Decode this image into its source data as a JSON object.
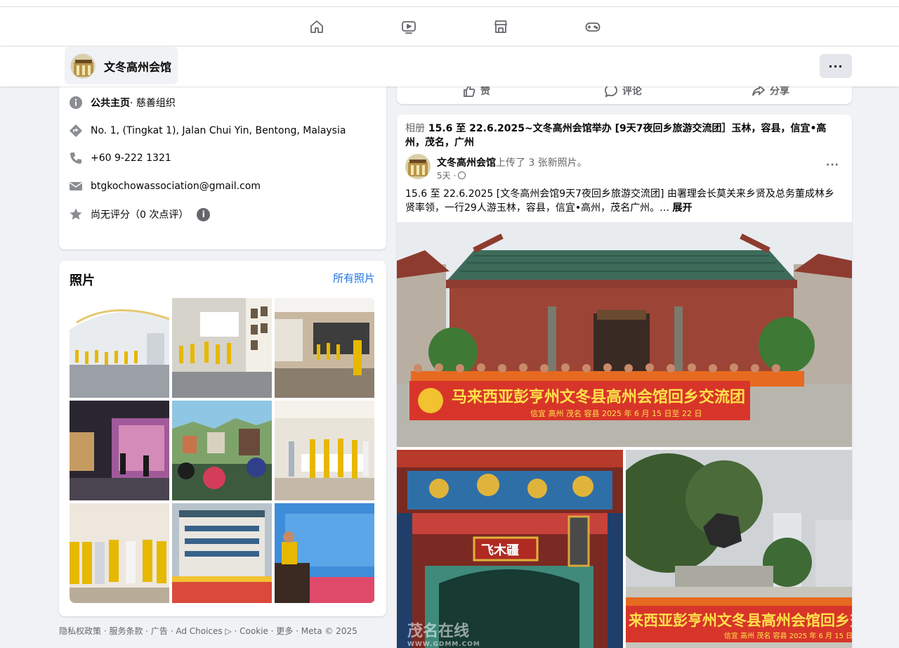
{
  "nav": {
    "icons": [
      "home-icon",
      "video-icon",
      "marketplace-icon",
      "gaming-icon"
    ]
  },
  "page": {
    "name": "文冬高州会馆",
    "more_label": "···"
  },
  "intro": {
    "category_bold": "公共主页",
    "category_rest": " · 慈善组织",
    "address": "No. 1, (Tingkat 1), Jalan Chui Yin, Bentong, Malaysia",
    "phone": "+60 9-222 1321",
    "email": "btgkochowassociation@gmail.com",
    "rating": "尚无评分（0 次点评）",
    "info_badge": "i"
  },
  "photos": {
    "title": "照片",
    "all_link": "所有照片"
  },
  "footer": {
    "text": "隐私权政策 · 服务条款 · 广告 · Ad Choices ▷ · Cookie · 更多 · Meta © 2025"
  },
  "prev_post": {
    "like": "赞",
    "comment": "评论",
    "share": "分享"
  },
  "post": {
    "album_label": "相册",
    "album_title": "15.6 至 22.6.2025~文冬高州会馆举办 [9天7夜回乡旅游交流团］玉林，容县，信宜•高州，茂名，广州",
    "author": "文冬高州会馆",
    "action": "上传了 3 张新照片。",
    "time": "5天 ·",
    "caption": "15.6 至 22.6.2025 [文冬高州会馆9天7夜回乡旅游交流团] 由署理会长莫关来乡贤及总务董成林乡贤率领，一行29人游玉林，容县，信宜•高州，茂名广州。…",
    "expand": "展开",
    "menu": "···",
    "banner_main": "马来西亚彭亨州文冬县高州会馆回乡交流团",
    "banner_sub": "信宜 高州 茂名 容县 2025 年 6 月 15 日至 22 日",
    "sign_text": "飞木疆",
    "banner_right": "来西亚彭亨州文冬县高州会馆回乡交",
    "banner_right_sub": "信宜 高州 茂名 容县 2025 年 6 月 15 日"
  },
  "watermark": {
    "main": "茂名在线",
    "sub": "WWW.GDMM.COM"
  }
}
